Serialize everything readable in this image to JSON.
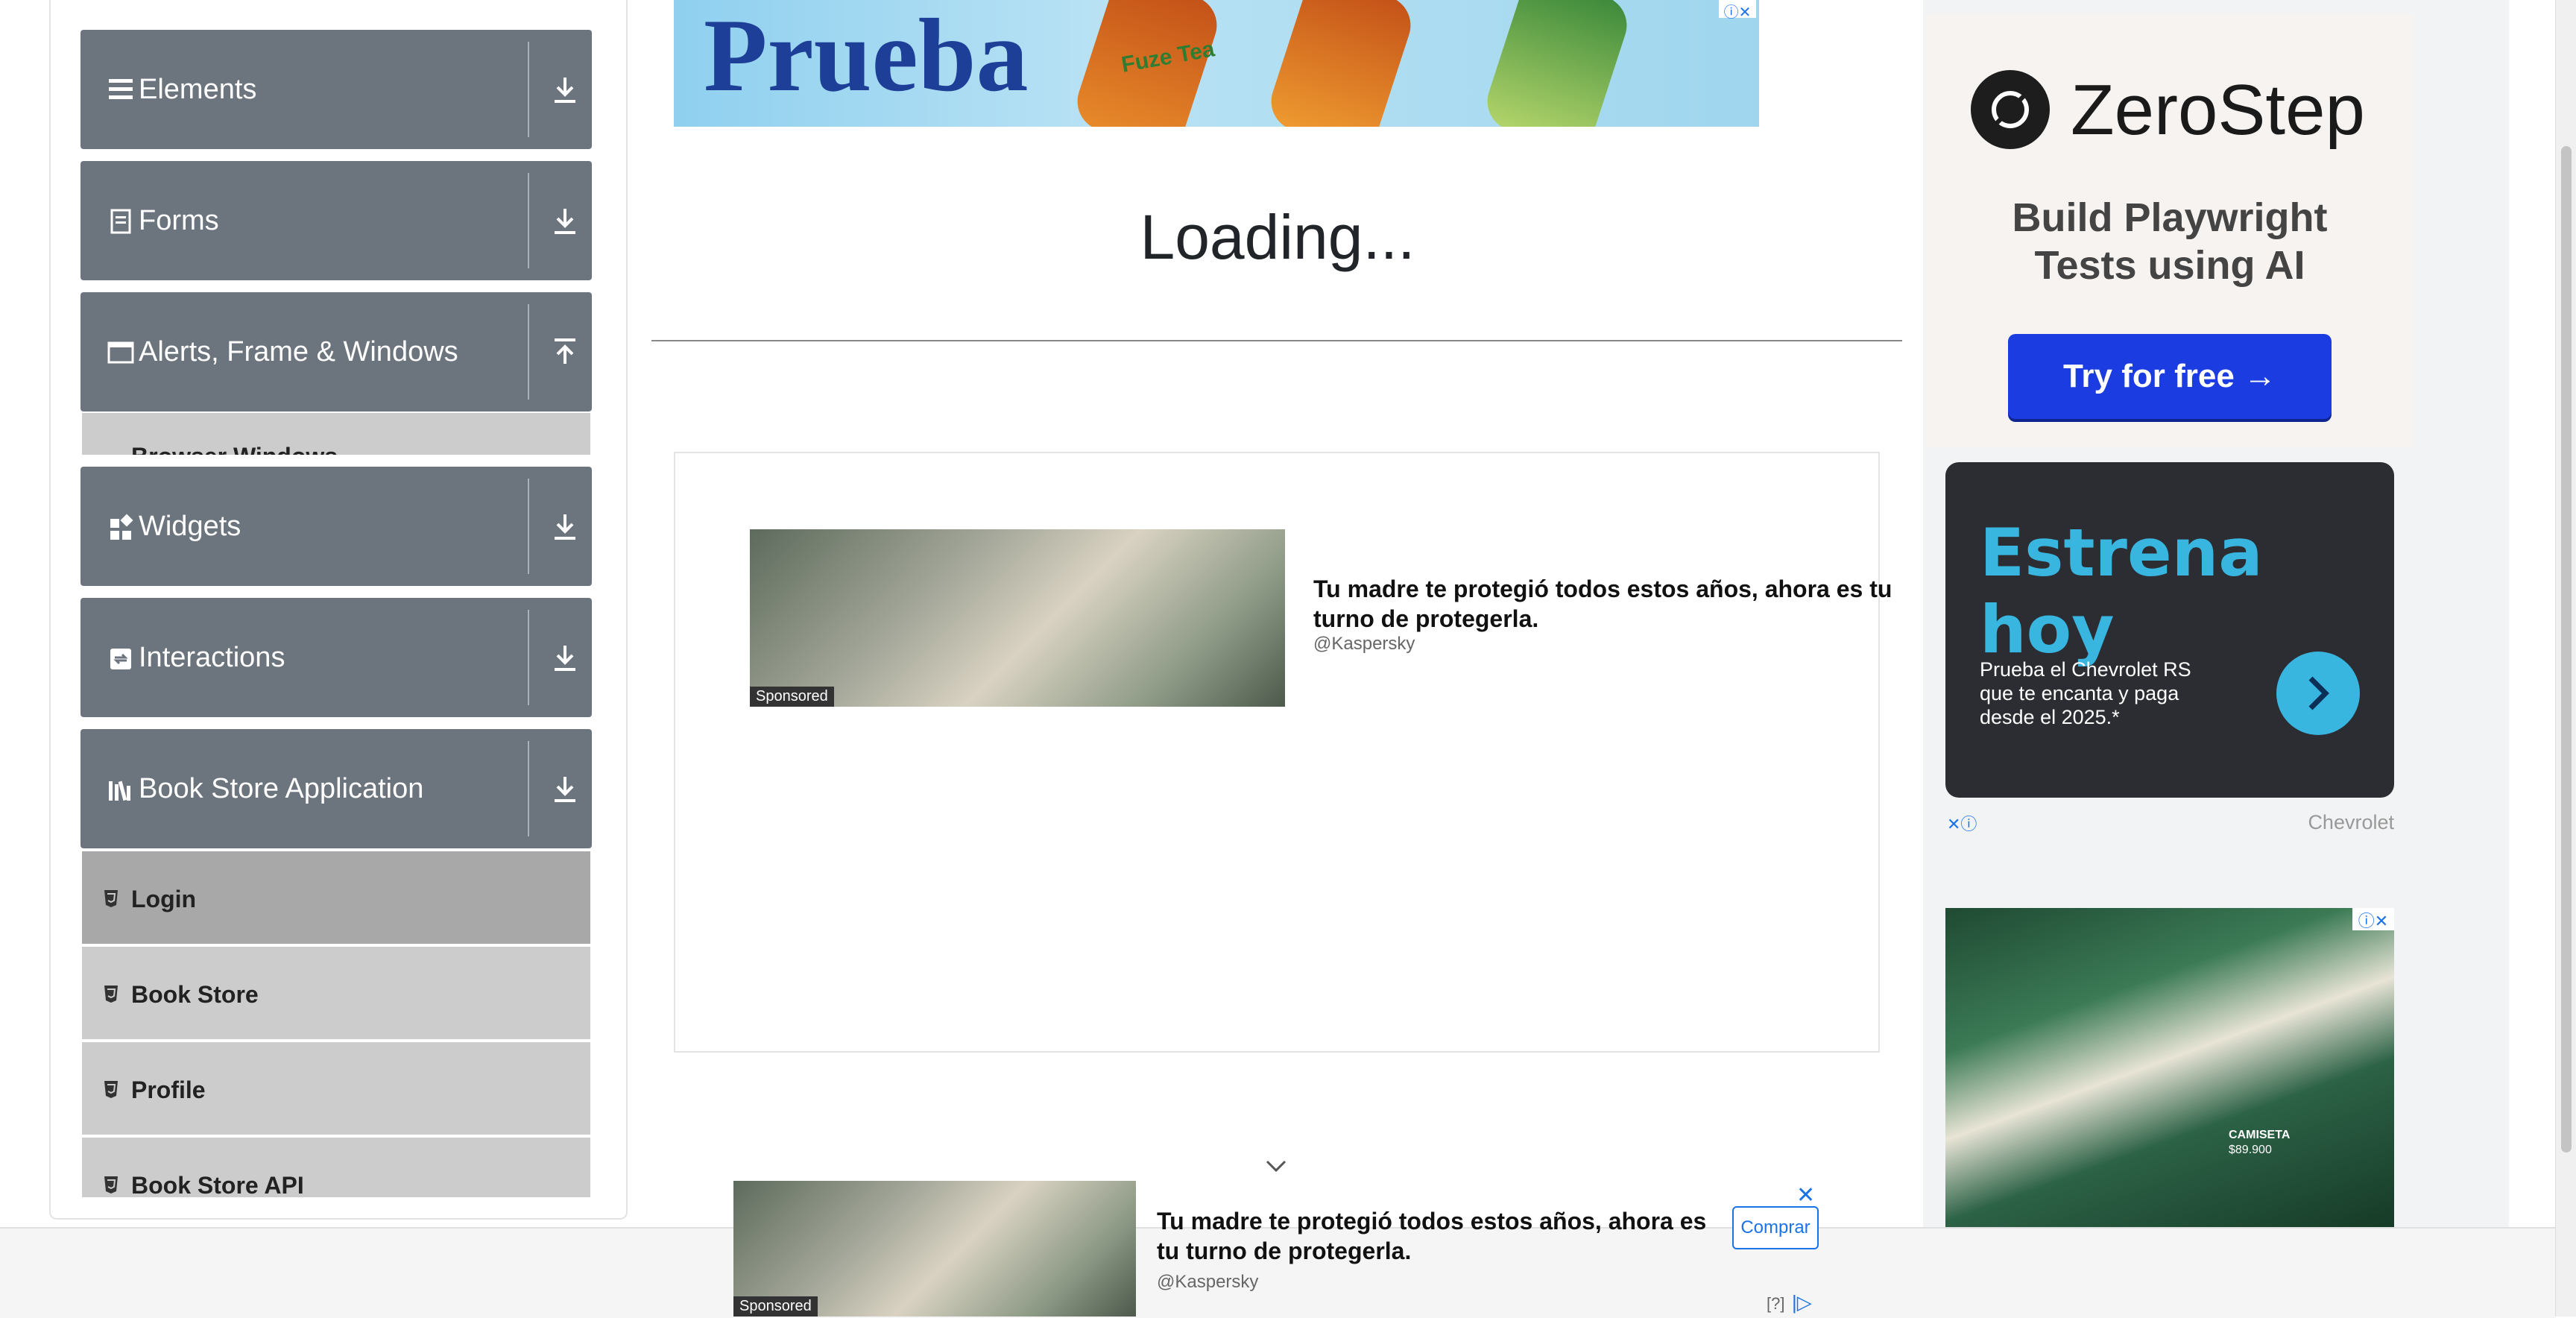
{
  "sidebar": {
    "groups": [
      {
        "label": "Elements",
        "icon": "menu-icon",
        "arrow": "download-icon"
      },
      {
        "label": "Forms",
        "icon": "document-icon",
        "arrow": "download-icon"
      },
      {
        "label": "Alerts, Frame & Windows",
        "icon": "window-icon",
        "arrow": "upload-icon"
      },
      {
        "label": "Widgets",
        "icon": "widgets-icon",
        "arrow": "download-icon"
      },
      {
        "label": "Interactions",
        "icon": "interactions-icon",
        "arrow": "download-icon"
      },
      {
        "label": "Book Store Application",
        "icon": "books-icon",
        "arrow": "download-icon"
      }
    ],
    "partial_item": "Browser Windows",
    "book_items": [
      {
        "label": "Login",
        "active": true
      },
      {
        "label": "Book Store",
        "active": false
      },
      {
        "label": "Profile",
        "active": false
      },
      {
        "label": "Book Store API",
        "active": false
      }
    ]
  },
  "main": {
    "top_banner_text": "Prueba",
    "top_banner_brand": "Fuze Tea",
    "loading": "Loading...",
    "ad": {
      "headline": "Tu madre te protegió todos estos años, ahora es tu turno de protegerla.",
      "source": "@Kaspersky",
      "sponsored": "Sponsored"
    }
  },
  "right_ads": {
    "zerostep": {
      "brand": "ZeroStep",
      "tagline": "Build Playwright Tests using AI",
      "cta": "Try for free →"
    },
    "chevrolet": {
      "headline": "Estrena hoy",
      "body": "Prueba el Chevrolet RS que te encanta y paga desde el 2025.*",
      "brand": "Chevrolet"
    },
    "fashion": {
      "text1": "CAMISETA",
      "text2": "$89.900"
    }
  },
  "footer_ad": {
    "headline": "Tu madre te protegió todos estos años, ahora es tu turno de protegerla.",
    "source": "@Kaspersky",
    "cta": "Comprar",
    "sponsored": "Sponsored",
    "help": "[?]"
  },
  "colors": {
    "group_bg": "#6c757d",
    "item_bg": "#cccccc",
    "zerostep_button": "#1a3ce0",
    "chevrolet_accent": "#38b6e0"
  }
}
